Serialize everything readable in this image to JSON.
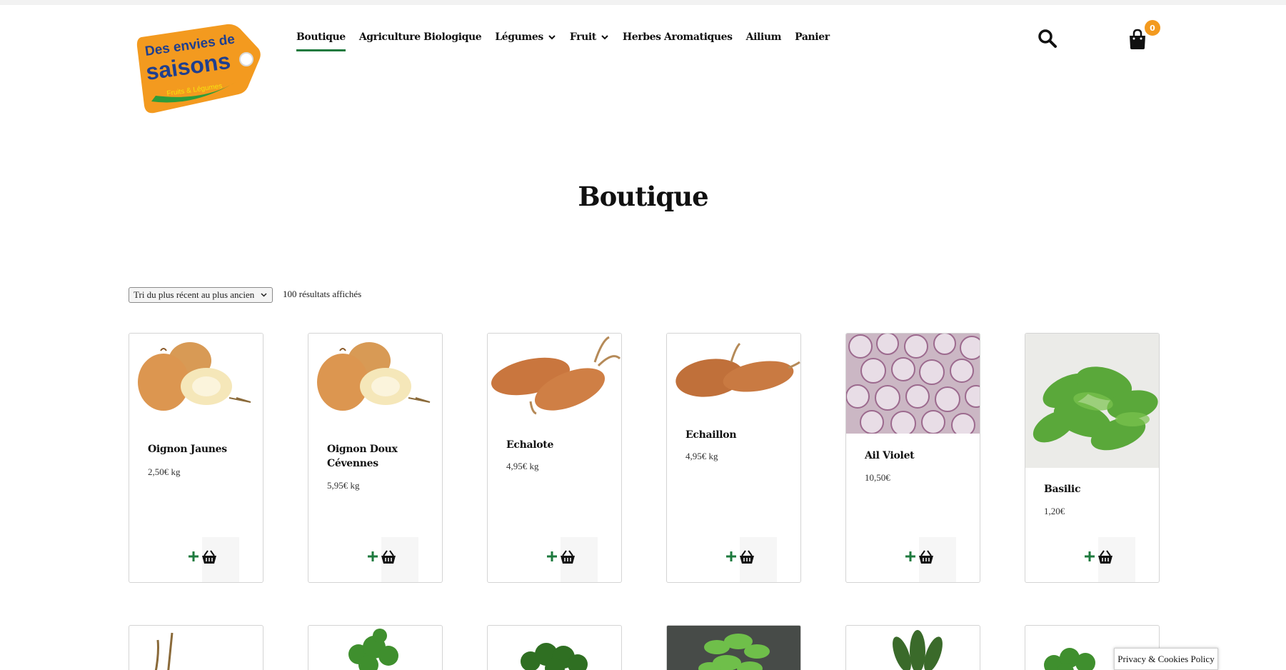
{
  "logo": {
    "line1": "Des envies de",
    "line2": "saisons",
    "line3": "Fruits & Légumes"
  },
  "nav": {
    "items": [
      {
        "label": "Boutique",
        "active": true
      },
      {
        "label": "Agriculture Biologique"
      },
      {
        "label": "Légumes",
        "dropdown": true
      },
      {
        "label": "Fruit",
        "dropdown": true
      },
      {
        "label": "Herbes Aromatiques"
      },
      {
        "label": "Ailium"
      },
      {
        "label": "Panier"
      }
    ]
  },
  "cart": {
    "count": "0"
  },
  "page": {
    "title": "Boutique"
  },
  "shop": {
    "sort_selected": "Tri du plus récent au plus ancien",
    "results": "100 résultats affichés"
  },
  "products": [
    {
      "name": "Oignon Jaunes",
      "price": "2,50€ kg"
    },
    {
      "name": "Oignon Doux Cévennes",
      "price": "5,95€ kg"
    },
    {
      "name": "Echalote",
      "price": "4,95€ kg"
    },
    {
      "name": "Echaillon",
      "price": "4,95€ kg"
    },
    {
      "name": "Ail Violet",
      "price": "10,50€"
    },
    {
      "name": "Basilic",
      "price": "1,20€"
    }
  ],
  "icons": {
    "search": "search-icon",
    "cart": "shopping-bag-icon",
    "add": "plus-icon",
    "basket": "basket-icon",
    "chevron": "chevron-down-icon"
  },
  "colors": {
    "accent_green": "#1d7a3e",
    "badge_orange": "#f39a1f",
    "logo_orange": "#f39a1f",
    "logo_blue": "#1f3f8f"
  },
  "footer": {
    "privacy": "Privacy & Cookies Policy"
  }
}
